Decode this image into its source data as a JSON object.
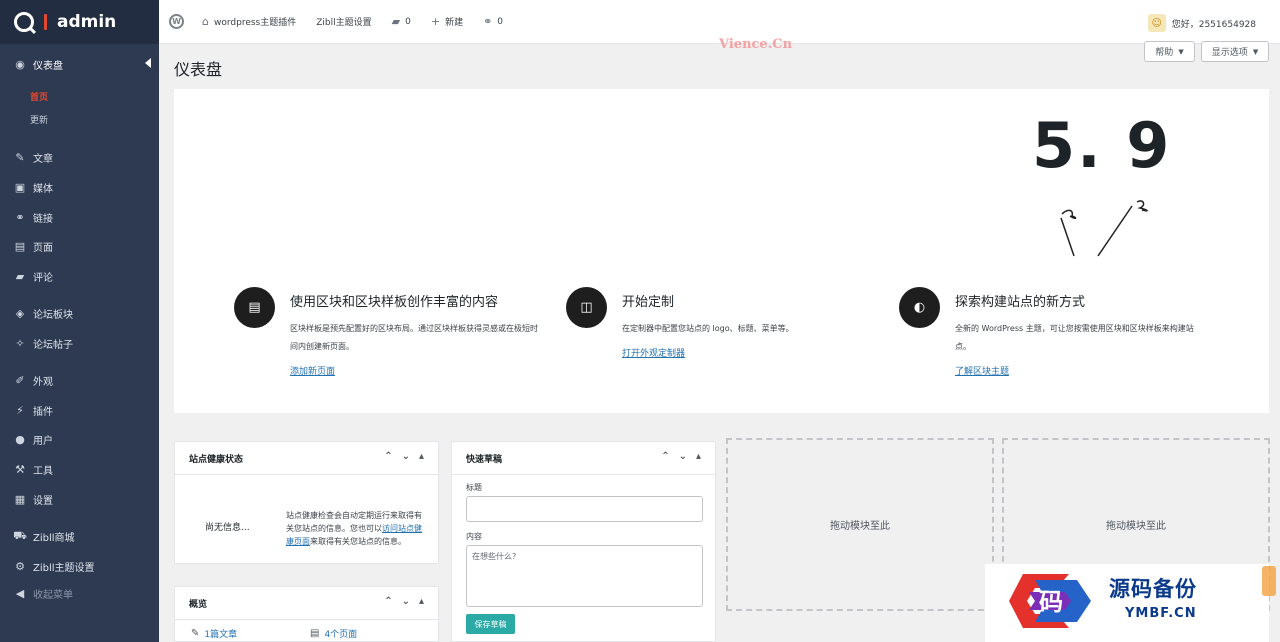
{
  "brand": {
    "name": "admin"
  },
  "sidebar": {
    "items": [
      {
        "label": "仪表盘",
        "icon": "dashboard-icon",
        "glyph": "◉"
      },
      {
        "label": "文章",
        "icon": "pin-icon",
        "glyph": "✎"
      },
      {
        "label": "媒体",
        "icon": "media-icon",
        "glyph": "▣"
      },
      {
        "label": "链接",
        "icon": "link-icon",
        "glyph": "⚭"
      },
      {
        "label": "页面",
        "icon": "page-icon",
        "glyph": "▤"
      },
      {
        "label": "评论",
        "icon": "comment-icon",
        "glyph": "▰"
      },
      {
        "label": "论坛板块",
        "icon": "forum-icon",
        "glyph": "◈"
      },
      {
        "label": "论坛帖子",
        "icon": "post-icon",
        "glyph": "✧"
      },
      {
        "label": "外观",
        "icon": "brush-icon",
        "glyph": "✐"
      },
      {
        "label": "插件",
        "icon": "plugin-icon",
        "glyph": "⚡"
      },
      {
        "label": "用户",
        "icon": "user-icon",
        "glyph": "●"
      },
      {
        "label": "工具",
        "icon": "tool-icon",
        "glyph": "⚒"
      },
      {
        "label": "设置",
        "icon": "settings-icon",
        "glyph": "▦"
      },
      {
        "label": "Zibll商城",
        "icon": "cart-icon",
        "glyph": "⛟"
      },
      {
        "label": "Zibll主题设置",
        "icon": "gear-icon",
        "glyph": "⚙"
      },
      {
        "label": "收起菜单",
        "icon": "collapse-icon",
        "glyph": "◀"
      }
    ],
    "sub_items": [
      "首页",
      "更新"
    ]
  },
  "adminbar": {
    "items": [
      {
        "label": "wordpress主题插件",
        "glyph": "⌂",
        "icon": "home-icon"
      },
      {
        "label": "Zibll主题设置",
        "glyph": "",
        "icon": ""
      },
      {
        "label": "0",
        "glyph": "▰",
        "icon": "comment-icon"
      },
      {
        "label": "新建",
        "glyph": "+",
        "icon": "plus-icon"
      },
      {
        "label": "0",
        "glyph": "⚭",
        "icon": "link-icon"
      }
    ],
    "greeting": "您好，2551654928"
  },
  "page": {
    "title": "仪表盘",
    "watermark": "Vience.Cn",
    "help_button": "帮助",
    "screen_options_button": "显示选项"
  },
  "welcome": {
    "version": "5. 9",
    "columns": [
      {
        "title": "使用区块和区块样板创作丰富的内容",
        "text": "区块样板是预先配置好的区块布局。通过区块样板获得灵感或在极短时间内创建新页面。",
        "link": "添加新页面",
        "glyph": "▤",
        "icon": "document-icon"
      },
      {
        "title": "开始定制",
        "text": "在定制器中配置您站点的 logo、标题、菜单等。",
        "link": "打开外观定制器",
        "glyph": "◫",
        "icon": "layout-icon"
      },
      {
        "title": "探索构建站点的新方式",
        "text": "全新的 WordPress 主题，可让您按需使用区块和区块样板来构建站点。",
        "link": "了解区块主题",
        "glyph": "◐",
        "icon": "contrast-icon"
      }
    ]
  },
  "health": {
    "title": "站点健康状态",
    "no_info": "尚无信息...",
    "text_before": "站点健康检查会自动定期运行来取得有关您站点的信息。您也可以",
    "link": "访问站点健康页面",
    "text_after": "来取得有关您站点的信息。"
  },
  "quickdraft": {
    "title": "快速草稿",
    "title_label": "标题",
    "content_label": "内容",
    "content_placeholder": "在想些什么?",
    "save_button": "保存草稿"
  },
  "glance": {
    "title": "概览",
    "posts": "1篇文章",
    "pages": "4个页面"
  },
  "dropzones": [
    "拖动模块至此",
    "拖动模块至此"
  ],
  "badge": {
    "title": "源码备份",
    "subtitle": "YMBF.CN",
    "logo_char": "码"
  }
}
